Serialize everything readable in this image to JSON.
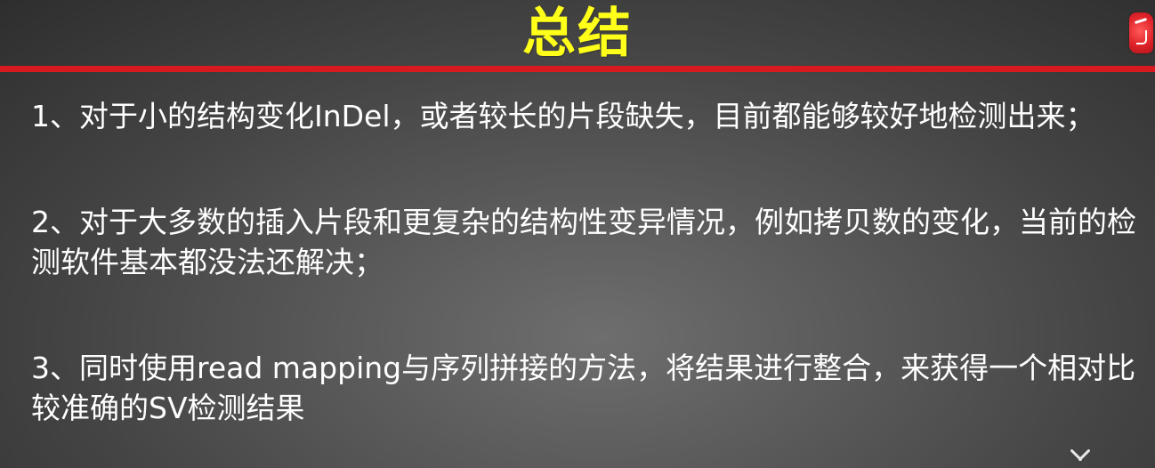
{
  "slide": {
    "title": "总结",
    "items": [
      "1、对于小的结构变化InDel，或者较长的片段缺失，目前都能够较好地检测出来；",
      "2、对于大多数的插入片段和更复杂的结构性变异情况，例如拷贝数的变化，当前的检测软件基本都没法还解决；",
      "3、同时使用read mapping与序列拼接的方法，将结果进行整合，来获得一个相对比较准确的SV检测结果"
    ]
  },
  "colors": {
    "title": "#ffff1a",
    "accent_rule": "#d71920",
    "body_text": "#ffffff",
    "background": "#4a4a4a"
  },
  "icons": {
    "logo": "red-seal-logo-icon",
    "nav": "chevron-down-icon"
  }
}
